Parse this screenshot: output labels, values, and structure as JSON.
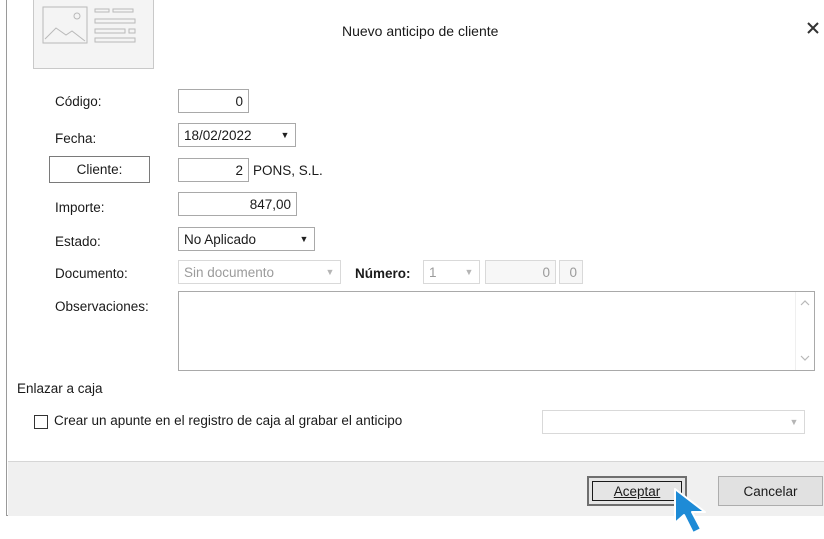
{
  "dialog": {
    "title": "Nuevo anticipo de cliente",
    "close_icon": "close-icon",
    "header_icon": "form-image-icon"
  },
  "fields": {
    "codigo": {
      "label": "Código:",
      "value": "0"
    },
    "fecha": {
      "label": "Fecha:",
      "value": "18/02/2022"
    },
    "cliente": {
      "button_label": "Cliente:",
      "number": "2",
      "name": "PONS, S.L."
    },
    "importe": {
      "label": "Importe:",
      "value": "847,00"
    },
    "estado": {
      "label": "Estado:",
      "value": "No Aplicado"
    },
    "documento": {
      "label": "Documento:",
      "value": "Sin documento"
    },
    "numero": {
      "label": "Número:",
      "series": "1",
      "value1": "0",
      "value2": "0"
    },
    "observaciones": {
      "label": "Observaciones:",
      "value": ""
    }
  },
  "caja": {
    "section_label": "Enlazar a caja",
    "checkbox_label": "Crear un apunte en el registro de caja al grabar el anticipo",
    "checked": false,
    "select_value": ""
  },
  "footer": {
    "accept_label": "Aceptar",
    "cancel_label": "Cancelar"
  },
  "colors": {
    "cursor": "#1e8bd6",
    "footer_bg": "#f0f0f0",
    "button_bg": "#e1e1e1"
  }
}
